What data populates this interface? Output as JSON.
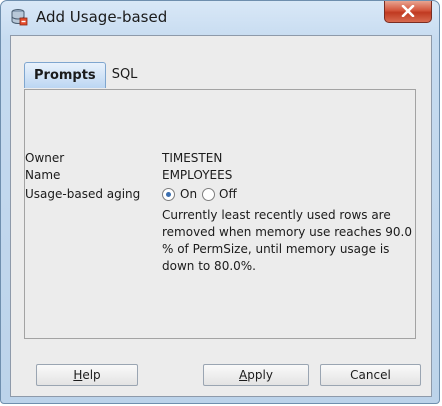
{
  "window": {
    "title": "Add Usage-based"
  },
  "tabs": [
    {
      "label": "Prompts",
      "active": true
    },
    {
      "label": "SQL",
      "active": false
    }
  ],
  "form": {
    "owner_label": "Owner",
    "owner_value": "TIMESTEN",
    "name_label": "Name",
    "name_value": "EMPLOYEES",
    "aging_label": "Usage-based aging",
    "aging_options": [
      {
        "label": "On",
        "selected": true
      },
      {
        "label": "Off",
        "selected": false
      }
    ],
    "description": "Currently least recently used rows are removed when memory use reaches 90.0 % of PermSize, until memory usage is down to 80.0%."
  },
  "buttons": {
    "help": {
      "mnemonic": "H",
      "rest": "elp"
    },
    "apply": {
      "mnemonic": "A",
      "rest": "pply"
    },
    "cancel": "Cancel"
  }
}
